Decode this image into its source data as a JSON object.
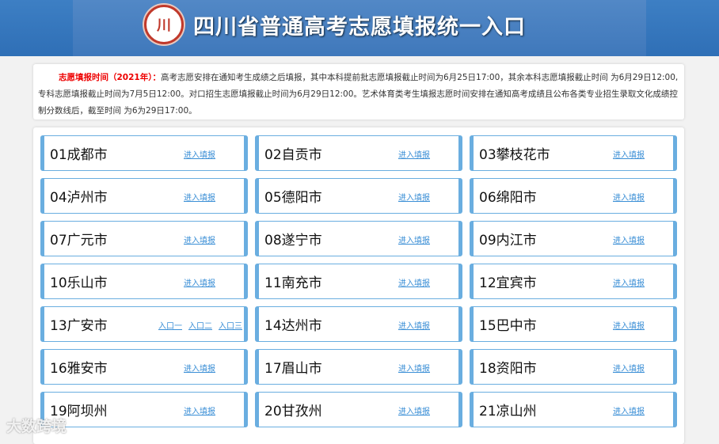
{
  "header": {
    "title": "四川省普通高考志愿填报统一入口",
    "logo_text": "川"
  },
  "notice": {
    "label": "志愿填报时间（2021年）：",
    "text": "高考志愿安排在通知考生成绩之后填报，其中本科提前批志愿填报截止时间为6月25日17:00，其余本科志愿填报截止时间 为6月29日12:00,专科志愿填报截止时间为7月5日12:00。对口招生志愿填报截止时间为6月29日12:00。艺术体育类考生填报志愿时间安排在通知高考成绩且公布各类专业招生录取文化成绩控制分数线后，截至时间 为6为29日17:00。"
  },
  "cities": [
    {
      "name": "01成都市",
      "links": [
        "进入填报"
      ]
    },
    {
      "name": "02自贡市",
      "links": [
        "进入填报"
      ]
    },
    {
      "name": "03攀枝花市",
      "links": [
        "进入填报"
      ]
    },
    {
      "name": "04泸州市",
      "links": [
        "进入填报"
      ]
    },
    {
      "name": "05德阳市",
      "links": [
        "进入填报"
      ]
    },
    {
      "name": "06绵阳市",
      "links": [
        "进入填报"
      ]
    },
    {
      "name": "07广元市",
      "links": [
        "进入填报"
      ]
    },
    {
      "name": "08遂宁市",
      "links": [
        "进入填报"
      ]
    },
    {
      "name": "09内江市",
      "links": [
        "进入填报"
      ]
    },
    {
      "name": "10乐山市",
      "links": [
        "进入填报"
      ]
    },
    {
      "name": "11南充市",
      "links": [
        "进入填报"
      ]
    },
    {
      "name": "12宜宾市",
      "links": [
        "进入填报"
      ]
    },
    {
      "name": "13广安市",
      "links": [
        "入口一",
        "入口二",
        "入口三"
      ]
    },
    {
      "name": "14达州市",
      "links": [
        "进入填报"
      ]
    },
    {
      "name": "15巴中市",
      "links": [
        "进入填报"
      ]
    },
    {
      "name": "16雅安市",
      "links": [
        "进入填报"
      ]
    },
    {
      "name": "17眉山市",
      "links": [
        "进入填报"
      ]
    },
    {
      "name": "18资阳市",
      "links": [
        "进入填报"
      ]
    },
    {
      "name": "19阿坝州",
      "links": [
        "进入填报"
      ]
    },
    {
      "name": "20甘孜州",
      "links": [
        "进入填报"
      ]
    },
    {
      "name": "21凉山州",
      "links": [
        "进入填报"
      ]
    }
  ],
  "watermark": "大数跨境"
}
